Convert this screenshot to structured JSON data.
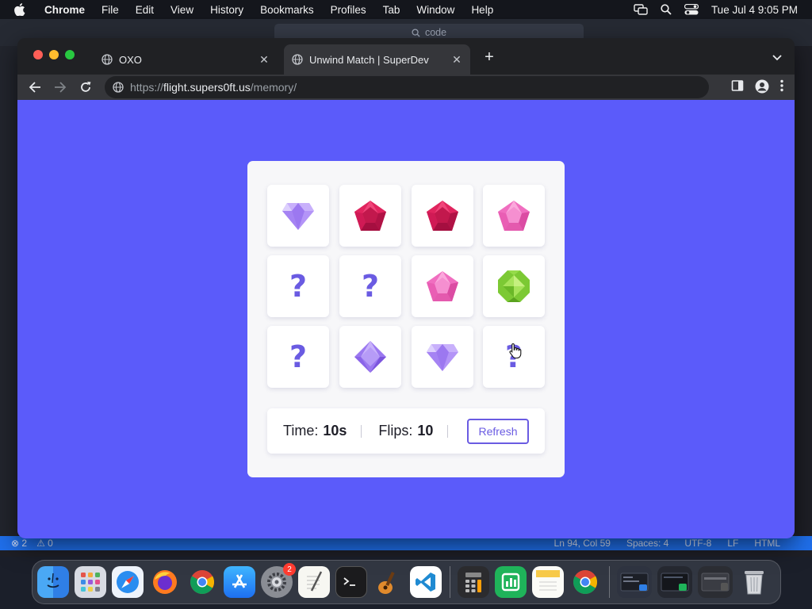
{
  "menubar": {
    "app_name": "Chrome",
    "items": [
      "File",
      "Edit",
      "View",
      "History",
      "Bookmarks",
      "Profiles",
      "Tab",
      "Window",
      "Help"
    ],
    "datetime": "Tue Jul 4  9:05 PM"
  },
  "vscode": {
    "command_center": "code",
    "status": {
      "errors": "2",
      "warnings": "0",
      "cursor": "Ln 94, Col 59",
      "spaces": "Spaces: 4",
      "encoding": "UTF-8",
      "eol": "LF",
      "language": "HTML"
    }
  },
  "browser": {
    "tabs": [
      {
        "title": "OXO",
        "active": false
      },
      {
        "title": "Unwind Match | SuperDev",
        "active": true
      }
    ],
    "url": {
      "scheme": "https://",
      "host": "flight.supers0ft.us",
      "path": "/memory/"
    }
  },
  "game": {
    "cards": [
      {
        "state": "revealed",
        "gem": "purple-diamond-gem"
      },
      {
        "state": "revealed",
        "gem": "red-pentagon-gem"
      },
      {
        "state": "revealed",
        "gem": "red-pentagon-gem"
      },
      {
        "state": "revealed",
        "gem": "pink-pentagon-gem"
      },
      {
        "state": "hidden",
        "label": "?"
      },
      {
        "state": "hidden",
        "label": "?"
      },
      {
        "state": "revealed",
        "gem": "pink-pentagon-gem"
      },
      {
        "state": "revealed",
        "gem": "green-octagon-gem"
      },
      {
        "state": "hidden",
        "label": "?"
      },
      {
        "state": "revealed",
        "gem": "purple-rhombus-gem"
      },
      {
        "state": "revealed",
        "gem": "purple-diamond-gem"
      },
      {
        "state": "hidden",
        "label": "?"
      }
    ],
    "time_label": "Time:",
    "time_value": "10s",
    "flips_label": "Flips:",
    "flips_value": "10",
    "refresh_label": "Refresh",
    "colors": {
      "page_bg": "#5b5bfa",
      "accent": "#6a5be2",
      "board_bg": "#f7f7f9"
    }
  },
  "dock": {
    "apps": [
      "finder-icon",
      "launchpad-icon",
      "safari-icon",
      "firefox-icon",
      "chrome-icon",
      "app-store-icon",
      "system-settings-icon",
      "textedit-icon",
      "terminal-icon",
      "garageband-icon",
      "vscode-icon",
      "calculator-icon",
      "numbers-icon",
      "notes-icon",
      "chrome-icon",
      "window-previews-icon",
      "trash-icon"
    ],
    "settings_badge": "2"
  }
}
